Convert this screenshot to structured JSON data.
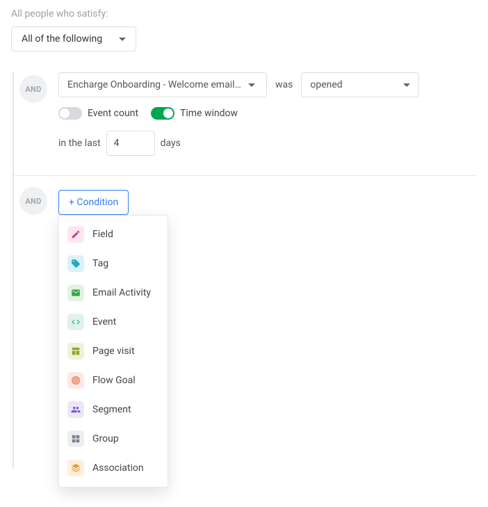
{
  "header": {
    "intro": "All people who satisfy:",
    "combinator": "All of the following"
  },
  "rule1": {
    "badge": "AND",
    "event_select": "Encharge Onboarding - Welcome email…",
    "verb": "was",
    "status_select": "opened",
    "toggle_event_count": {
      "label": "Event count",
      "on": false
    },
    "toggle_time_window": {
      "label": "Time window",
      "on": true
    },
    "time": {
      "prefix": "in the last",
      "value": "4",
      "suffix": "days"
    }
  },
  "add": {
    "badge": "AND",
    "button": "+ Condition",
    "menu": [
      {
        "label": "Field",
        "icon": "pencil-icon",
        "bg": "bg-field"
      },
      {
        "label": "Tag",
        "icon": "tag-icon",
        "bg": "bg-tag"
      },
      {
        "label": "Email Activity",
        "icon": "mail-icon",
        "bg": "bg-email"
      },
      {
        "label": "Event",
        "icon": "code-icon",
        "bg": "bg-event"
      },
      {
        "label": "Page visit",
        "icon": "layout-icon",
        "bg": "bg-page"
      },
      {
        "label": "Flow Goal",
        "icon": "target-icon",
        "bg": "bg-goal"
      },
      {
        "label": "Segment",
        "icon": "people-icon",
        "bg": "bg-segment"
      },
      {
        "label": "Group",
        "icon": "group-icon",
        "bg": "bg-group"
      },
      {
        "label": "Association",
        "icon": "link-icon",
        "bg": "bg-assoc"
      }
    ]
  }
}
